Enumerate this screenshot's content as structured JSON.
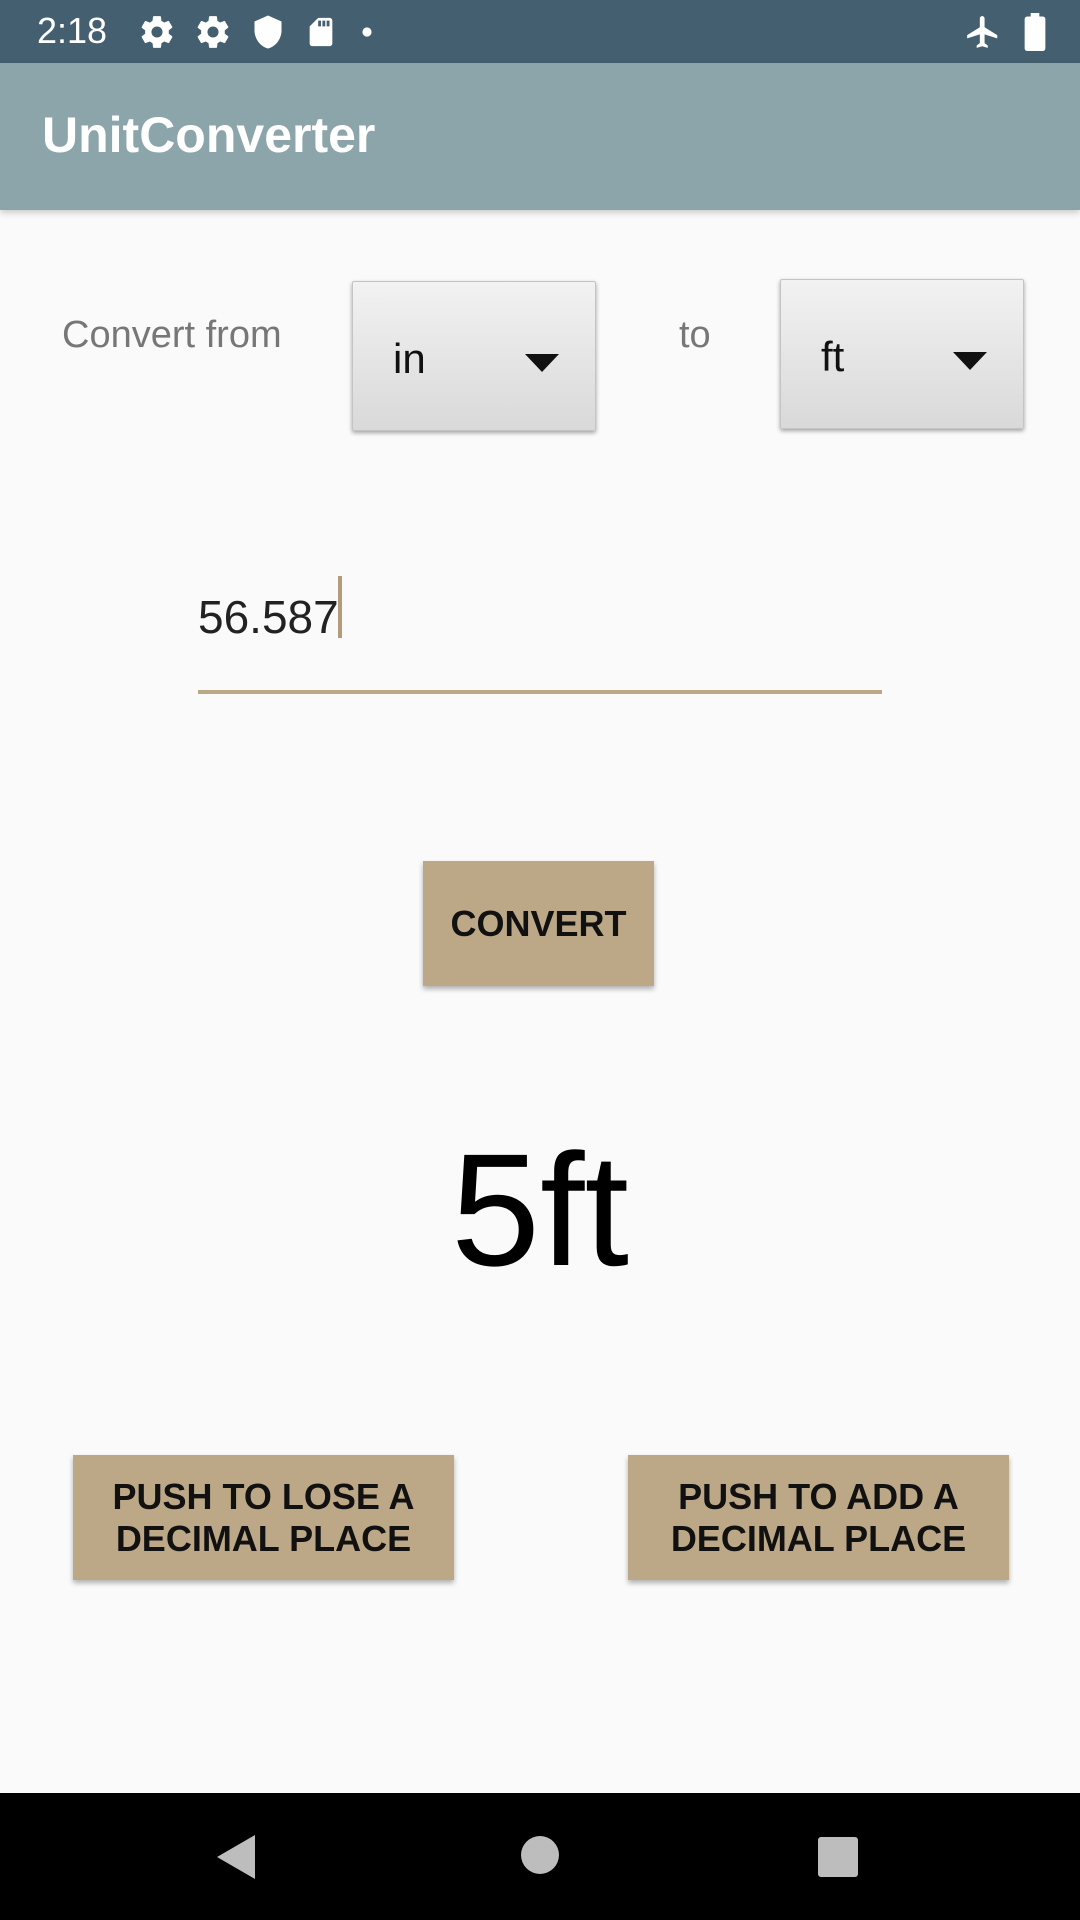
{
  "status_bar": {
    "time": "2:18",
    "icons_left": [
      "gear-icon",
      "gear-icon",
      "shield-icon",
      "sd-card-icon",
      "dot-icon"
    ],
    "icons_right": [
      "airplane-icon",
      "battery-icon"
    ]
  },
  "app_bar": {
    "title": "UnitConverter"
  },
  "converter": {
    "from_label": "Convert from",
    "from_unit": "in",
    "to_label": "to",
    "to_unit": "ft",
    "input_value": "56.587",
    "convert_label": "CONVERT",
    "result": "5ft",
    "lose_decimal_label": "PUSH TO LOSE A DECIMAL PLACE",
    "add_decimal_label": "PUSH TO ADD A DECIMAL PLACE"
  },
  "nav_bar": {
    "buttons": [
      "back-icon",
      "home-icon",
      "recents-icon"
    ]
  },
  "colors": {
    "status_bar": "#445f70",
    "app_bar": "#8ca5ab",
    "accent": "#bca886",
    "background": "#fafafa"
  }
}
